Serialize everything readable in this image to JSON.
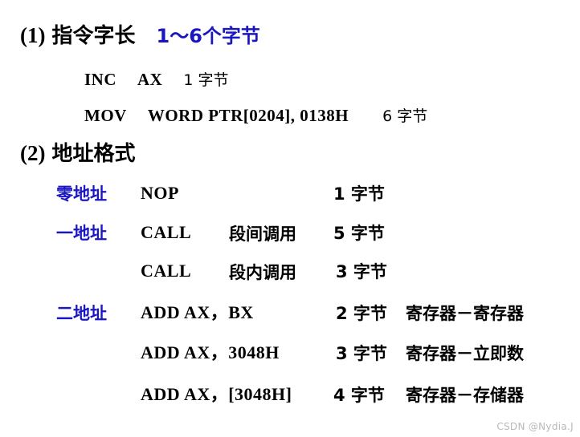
{
  "page": {
    "background_color": "#ffffff",
    "text_color": "#000000",
    "accent_color": "#1a16c0",
    "watermark": "CSDN @Nydia.J"
  },
  "sections": [
    {
      "id": "instruction-length",
      "number": "(1)",
      "title": "指令字长",
      "accent": "1～6个字节",
      "examples": [
        {
          "mnemonic": "INC",
          "operands": "AX",
          "size": "1 字节"
        },
        {
          "mnemonic": "MOV",
          "operands": "WORD PTR[0204], 0138H",
          "size": "6 字节"
        }
      ]
    },
    {
      "id": "address-format",
      "number": "(2)",
      "title": "地址格式",
      "rows": [
        {
          "label": "零地址",
          "instruction": "NOP",
          "detail": "",
          "size": "1 字节",
          "operand_type": ""
        },
        {
          "label": "一地址",
          "instruction": "CALL",
          "detail": "段间调用",
          "size": "5 字节",
          "operand_type": ""
        },
        {
          "label": "",
          "instruction": "CALL",
          "detail": "段内调用",
          "size": "3 字节",
          "operand_type": ""
        },
        {
          "label": "二地址",
          "instruction": "ADD AX，BX",
          "detail": "",
          "size": "2 字节",
          "operand_type": "寄存器－寄存器"
        },
        {
          "label": "",
          "instruction": "ADD AX，3048H",
          "detail": "",
          "size": "3 字节",
          "operand_type": "寄存器－立即数"
        },
        {
          "label": "",
          "instruction": "ADD AX，[3048H]",
          "detail": "",
          "size": "4 字节",
          "operand_type": "寄存器－存储器"
        }
      ]
    }
  ]
}
